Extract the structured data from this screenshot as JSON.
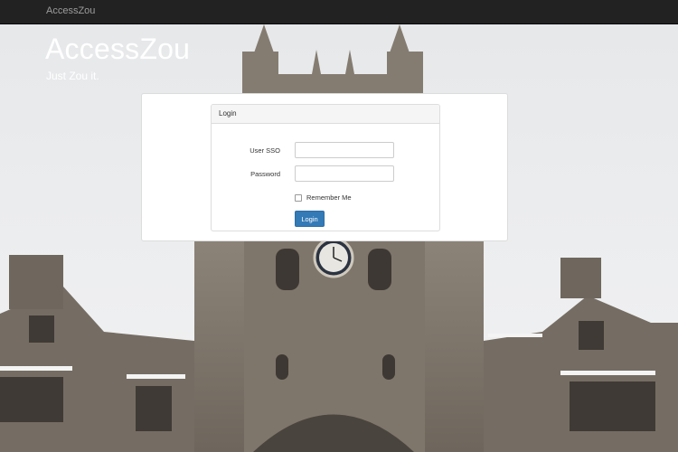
{
  "navbar": {
    "brand": "AccessZou"
  },
  "hero": {
    "title": "AccessZou",
    "tagline": "Just Zou it."
  },
  "login_panel": {
    "heading": "Login",
    "user_label": "User SSO",
    "user_value": "",
    "password_label": "Password",
    "password_value": "",
    "remember_label": "Remember Me",
    "remember_checked": false,
    "submit_label": "Login"
  },
  "background": {
    "icon": "clock-tower-photo"
  },
  "colors": {
    "navbar_bg": "#222222",
    "navbar_text": "#9d9d9d",
    "primary_button": "#337ab7",
    "panel_heading_bg": "#f5f5f5"
  }
}
